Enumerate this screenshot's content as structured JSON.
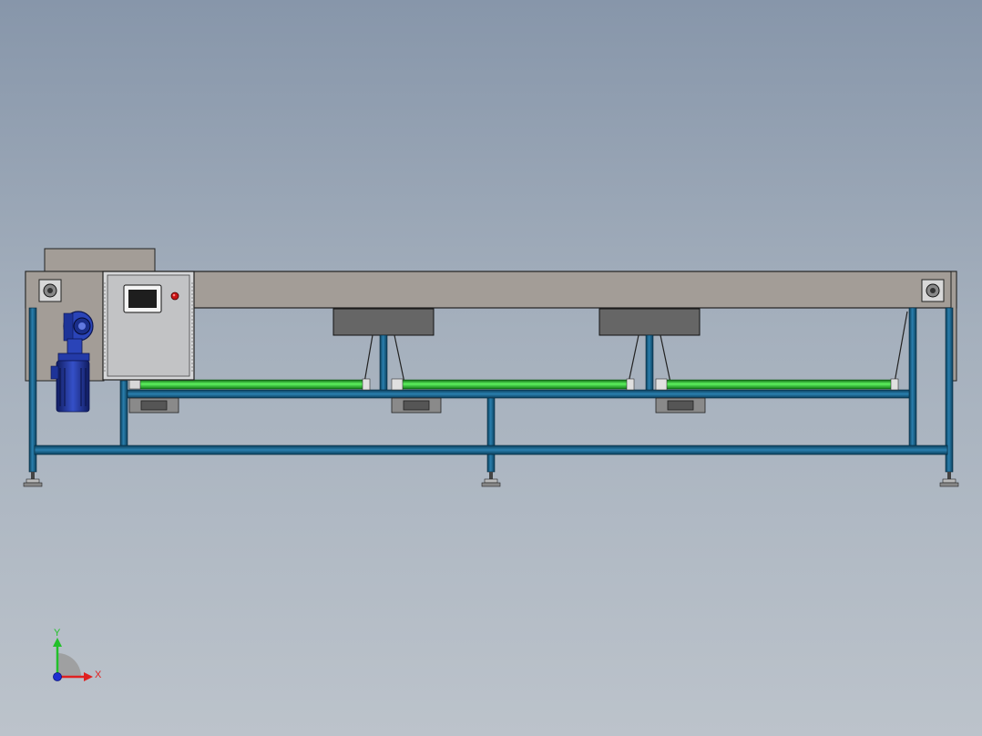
{
  "view": {
    "colors": {
      "background_top": "#8796aa",
      "background_bottom": "#bcc3cb",
      "frame_blue": "#1f6f9a",
      "frame_blue_dark": "#0b3f5c",
      "cover_gray": "#a39d97",
      "enclosure_gray": "#c2c3c5",
      "belt_green": "#35c83a",
      "motor_blue": "#243a9e"
    },
    "components": {
      "conveyor_cover": "conveyor-top-cover",
      "control_cabinet": "electrical-control-cabinet",
      "hmi_screen": "touch-screen-panel",
      "indicator_light": "red-indicator-light",
      "drive_motor": "gear-motor",
      "rollers": "green-conveyor-rollers",
      "pressing_blocks": "gray-pressing-blocks",
      "leveling_feet": "adjustable-leveling-feet"
    }
  },
  "triad": {
    "y_label": "Y",
    "x_label": "X",
    "y_color": "#22c02a",
    "x_color": "#e02020",
    "origin_color": "#1f2fd0"
  }
}
